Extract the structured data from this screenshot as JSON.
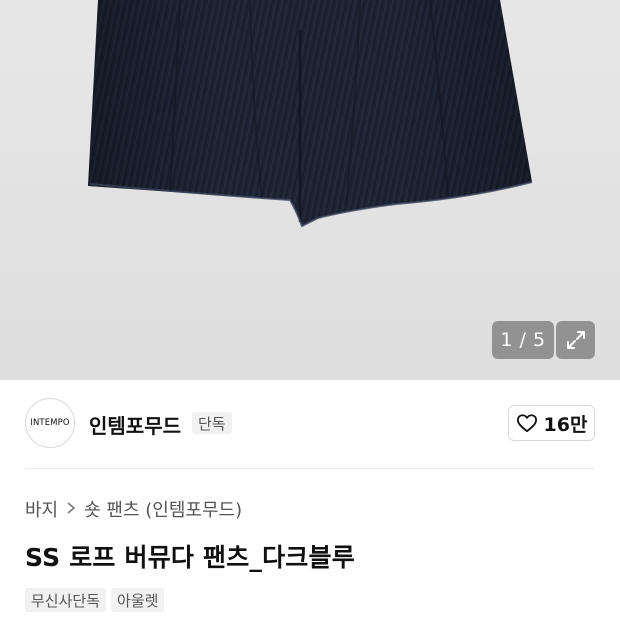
{
  "gallery": {
    "image_alt": "dark blue denim bermuda shorts",
    "counter": "1 / 5"
  },
  "brand": {
    "logo_text": "INTEMPO",
    "name": "인템포무드",
    "badge": "단독",
    "like_count": "16만"
  },
  "breadcrumb": {
    "category": "바지",
    "subcategory": "숏 팬츠 (인템포무드)"
  },
  "product": {
    "title": "SS 로프 버뮤다 팬츠_다크블루",
    "tags": [
      "무신사단독",
      "아울렛"
    ]
  },
  "colors": {
    "denim": "#1c2331",
    "background": "#e3e3e3"
  }
}
